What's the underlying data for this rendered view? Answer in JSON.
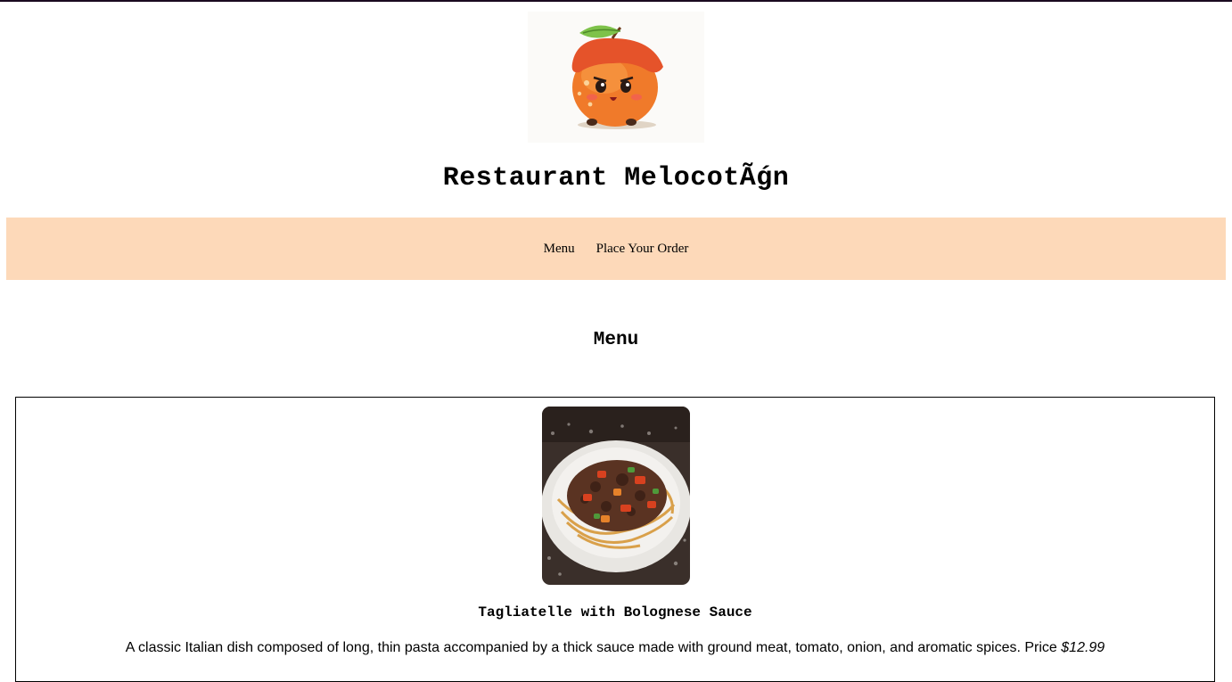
{
  "header": {
    "logo_alt": "peach mascot logo",
    "title": "Restaurant MelocotÃǵn"
  },
  "nav": {
    "items": [
      {
        "label": "Menu"
      },
      {
        "label": "Place Your Order"
      }
    ],
    "background": "#fdd9b9"
  },
  "menu": {
    "title": "Menu",
    "dishes": [
      {
        "name": "Tagliatelle with Bolognese Sauce",
        "description": "A classic Italian dish composed of long, thin pasta accompanied by a thick sauce made with ground meat, tomato, onion, and aromatic spices.",
        "price_label": "Price",
        "price": "$12.99",
        "image": "pasta-dish-photo"
      }
    ]
  }
}
